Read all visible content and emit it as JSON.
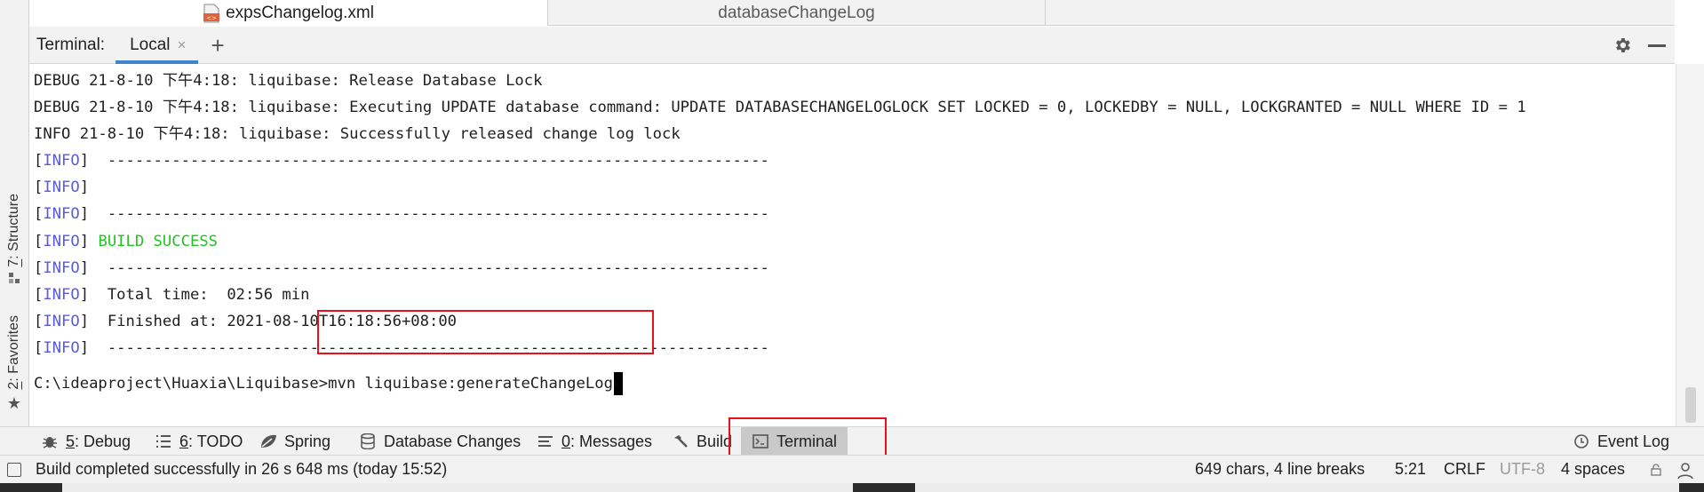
{
  "editor_tabs": [
    {
      "label": "expsChangelog.xml",
      "active": true
    },
    {
      "label": "databaseChangeLog",
      "active": false
    }
  ],
  "terminal": {
    "title": "Terminal:",
    "tab_local": "Local",
    "tab_close_icon": "×",
    "add_tab_icon": "+",
    "lines": [
      {
        "tag": "",
        "text": "DEBUG 21-8-10 下午4:18: liquibase: Release Database Lock"
      },
      {
        "tag": "",
        "text": "DEBUG 21-8-10 下午4:18: liquibase: Executing UPDATE database command: UPDATE DATABASECHANGELOGLOCK SET LOCKED = 0, LOCKEDBY = NULL, LOCKGRANTED = NULL WHERE ID = 1"
      },
      {
        "tag": "",
        "text": "INFO 21-8-10 下午4:18: liquibase: Successfully released change log lock"
      },
      {
        "tag": "INFO",
        "text": " ------------------------------------------------------------------------"
      },
      {
        "tag": "INFO",
        "text": ""
      },
      {
        "tag": "INFO",
        "text": " ------------------------------------------------------------------------"
      },
      {
        "tag": "INFO",
        "text": "BUILD SUCCESS"
      },
      {
        "tag": "INFO",
        "text": " ------------------------------------------------------------------------"
      },
      {
        "tag": "INFO",
        "text": " Total time:  02:56 min"
      },
      {
        "tag": "INFO",
        "text": " Finished at: 2021-08-10T16:18:56+08:00"
      },
      {
        "tag": "INFO",
        "text": " ------------------------------------------------------------------------"
      }
    ],
    "prompt": "C:\\ideaproject\\Huaxia\\Liquibase>",
    "command": "mvn liquibase:generateChangeLog"
  },
  "left_tools": [
    {
      "num": "7",
      "label": ": Structure"
    },
    {
      "num": "2",
      "label": ": Favorites"
    }
  ],
  "bottom_tools": {
    "debug": {
      "num": "5",
      "label": ": Debug"
    },
    "todo": {
      "num": "6",
      "label": ": TODO"
    },
    "spring": "Spring",
    "db_changes": "Database Changes",
    "messages": {
      "num": "0",
      "label": ": Messages"
    },
    "build": "Build",
    "terminal": "Terminal",
    "event_log": "Event Log"
  },
  "status": {
    "message": "Build completed successfully in 26 s 648 ms (today 15:52)",
    "chars": "649 chars, 4 line breaks",
    "position": "5:21",
    "line_sep": "CRLF",
    "encoding": "UTF-8",
    "indent": "4 spaces"
  },
  "colors": {
    "info_tag": "#5a5ade",
    "success": "#25c225",
    "highlight_box": "#e8111b",
    "active_tab_underline": "#4083c9"
  },
  "icons": [
    "xml-file-icon",
    "gear-icon",
    "minimize-icon",
    "bug-icon",
    "list-icon",
    "spring-leaf-icon",
    "database-icon",
    "messages-icon",
    "hammer-icon",
    "terminal-icon",
    "event-log-icon",
    "structure-icon",
    "star-icon",
    "lock-icon",
    "person-icon"
  ]
}
